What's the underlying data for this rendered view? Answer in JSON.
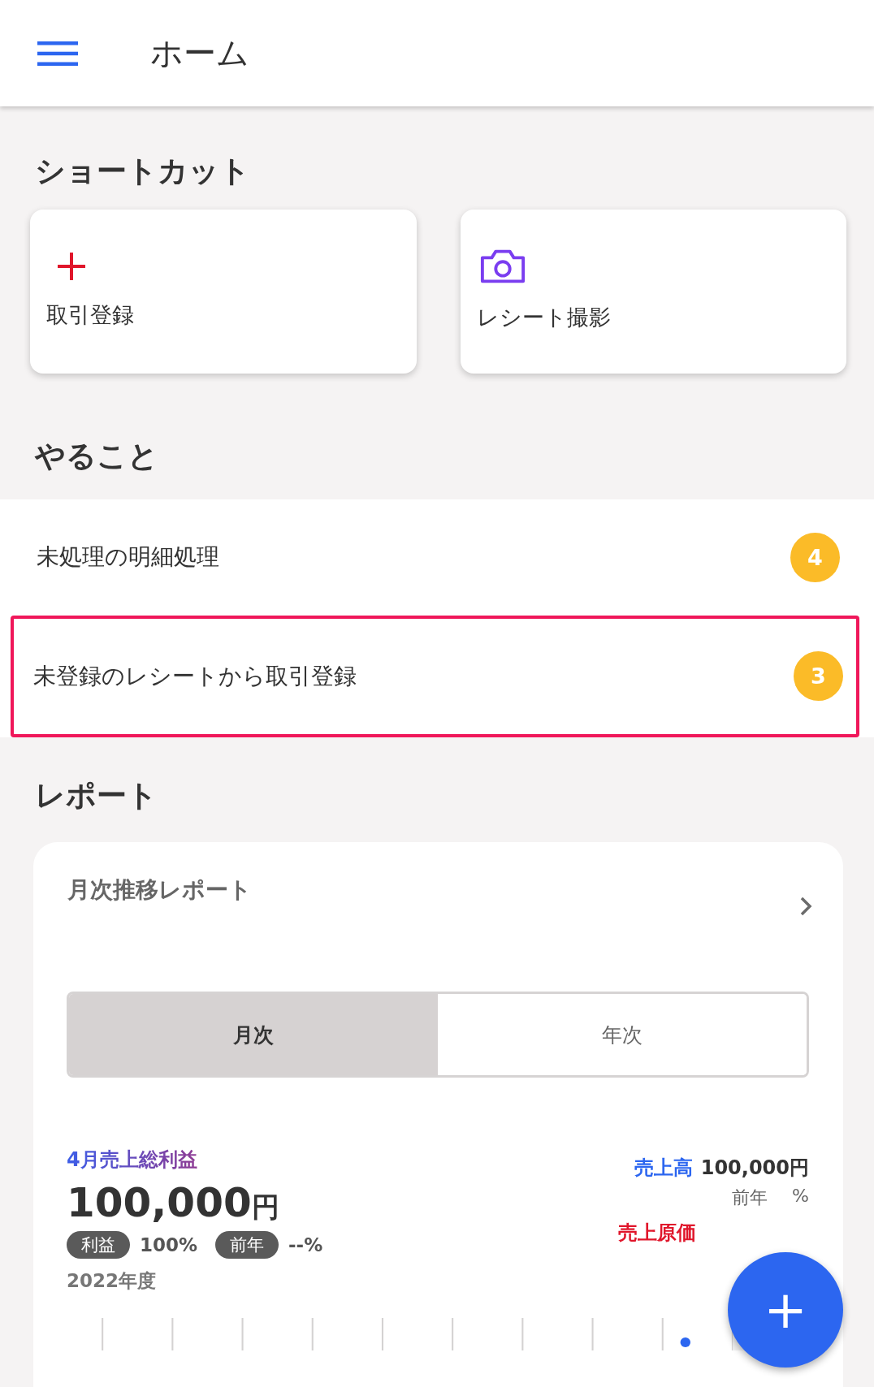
{
  "header": {
    "title": "ホーム"
  },
  "shortcuts": {
    "heading": "ショートカット",
    "items": [
      {
        "kind": "add",
        "label": "取引登録"
      },
      {
        "kind": "camera",
        "label": "レシート撮影"
      }
    ]
  },
  "todo": {
    "heading": "やること",
    "items": [
      {
        "label": "未処理の明細処理",
        "count": "4",
        "selected": false
      },
      {
        "label": "未登録のレシートから取引登録",
        "count": "3",
        "selected": true
      }
    ]
  },
  "report": {
    "heading": "レポート",
    "card": {
      "title": "月次推移レポート",
      "tabs": [
        {
          "label": "月次",
          "selected": true
        },
        {
          "label": "年次",
          "selected": false
        }
      ],
      "metric_title": "4月売上総利益",
      "amount": "100,000",
      "unit": "円",
      "chips": [
        {
          "label": "利益",
          "value": "100%"
        },
        {
          "label": "前年",
          "value": "--%"
        }
      ],
      "period": "2022年度",
      "sales": {
        "label": "売上高",
        "value": "100,000円",
        "prev_label": "前年",
        "prev_value": "%"
      },
      "cost": {
        "label": "売上原価"
      }
    }
  },
  "fab": {
    "label": "+"
  }
}
